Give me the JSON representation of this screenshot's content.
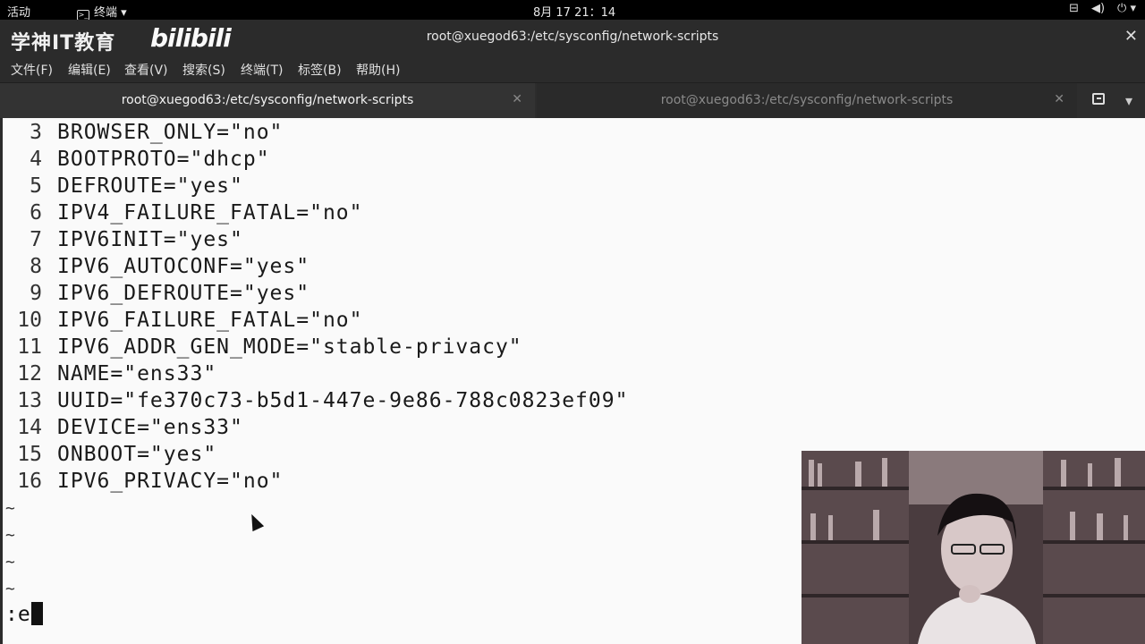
{
  "topbar": {
    "activities": "活动",
    "app_name": "终端",
    "app_arrow": "▾",
    "clock": "8月 17  21：14",
    "status_icons": [
      "network-icon",
      "volume-icon",
      "power-icon"
    ],
    "status_glyphs": [
      "⊟",
      "◀)",
      "⏻ ▾"
    ]
  },
  "titlebar": {
    "watermark": "学神IT教育",
    "bilibili": "bilibili",
    "title": "root@xuegod63:/etc/sysconfig/network-scripts",
    "close": "✕"
  },
  "menu": {
    "items": [
      "文件(F)",
      "编辑(E)",
      "查看(V)",
      "搜索(S)",
      "终端(T)",
      "标签(B)",
      "帮助(H)"
    ]
  },
  "tabs": [
    {
      "label": "root@xuegod63:/etc/sysconfig/network-scripts",
      "active": true,
      "close": "✕"
    },
    {
      "label": "root@xuegod63:/etc/sysconfig/network-scripts",
      "active": false,
      "close": "✕"
    }
  ],
  "tab_scroll": "▾",
  "editor": {
    "lines": [
      {
        "num": "3",
        "text": "BROWSER_ONLY=\"no\""
      },
      {
        "num": "4",
        "text": "BOOTPROTO=\"dhcp\""
      },
      {
        "num": "5",
        "text": "DEFROUTE=\"yes\""
      },
      {
        "num": "6",
        "text": "IPV4_FAILURE_FATAL=\"no\""
      },
      {
        "num": "7",
        "text": "IPV6INIT=\"yes\""
      },
      {
        "num": "8",
        "text": "IPV6_AUTOCONF=\"yes\""
      },
      {
        "num": "9",
        "text": "IPV6_DEFROUTE=\"yes\""
      },
      {
        "num": "10",
        "text": "IPV6_FAILURE_FATAL=\"no\""
      },
      {
        "num": "11",
        "text": "IPV6_ADDR_GEN_MODE=\"stable-privacy\""
      },
      {
        "num": "12",
        "text": "NAME=\"ens33\""
      },
      {
        "num": "13",
        "text": "UUID=\"fe370c73-b5d1-447e-9e86-788c0823ef09\""
      },
      {
        "num": "14",
        "text": "DEVICE=\"ens33\""
      },
      {
        "num": "15",
        "text": "ONBOOT=\"yes\""
      },
      {
        "num": "16",
        "text": "IPV6_PRIVACY=\"no\""
      }
    ],
    "tildes": [
      "~",
      "~",
      "~",
      "~"
    ],
    "command": ":e"
  }
}
